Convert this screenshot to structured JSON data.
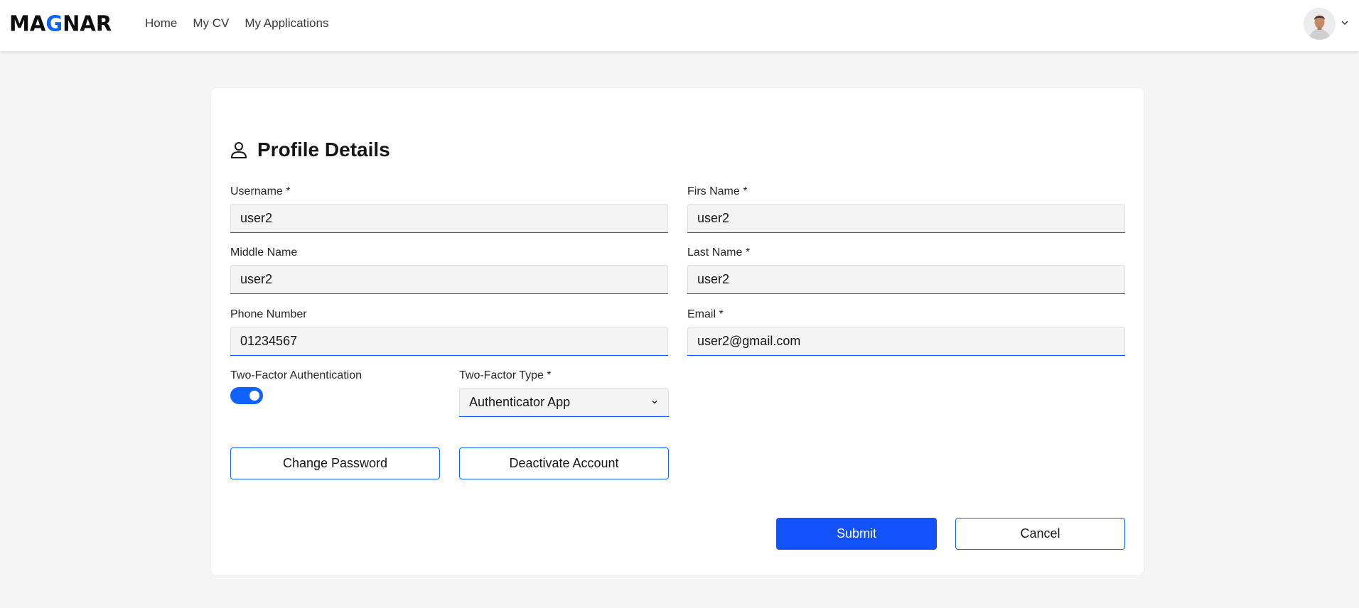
{
  "header": {
    "logo_part1": "MA",
    "logo_accent": "G",
    "logo_part2": "NAR",
    "nav": [
      "Home",
      "My CV",
      "My Applications"
    ],
    "avatar_icon": "user-avatar",
    "menu_icon": "chevron-down-icon"
  },
  "profile": {
    "title": "Profile Details",
    "title_icon": "user-icon",
    "fields": {
      "username": {
        "label": "Username *",
        "value": "user2"
      },
      "first_name": {
        "label": "Firs Name *",
        "value": "user2"
      },
      "middle_name": {
        "label": "Middle Name",
        "value": "user2"
      },
      "last_name": {
        "label": "Last Name *",
        "value": "user2"
      },
      "phone": {
        "label": "Phone Number",
        "value": "01234567"
      },
      "email": {
        "label": "Email *",
        "value": "user2@gmail.com"
      }
    },
    "two_factor": {
      "label": "Two-Factor Authentication",
      "enabled": true
    },
    "two_factor_type": {
      "label": "Two-Factor Type *",
      "value": "Authenticator App"
    },
    "buttons": {
      "change_password": "Change Password",
      "deactivate": "Deactivate Account",
      "submit": "Submit",
      "cancel": "Cancel"
    }
  },
  "colors": {
    "accent": "#0f62fe",
    "submit": "#1351fb",
    "background": "#f5f5f5"
  }
}
